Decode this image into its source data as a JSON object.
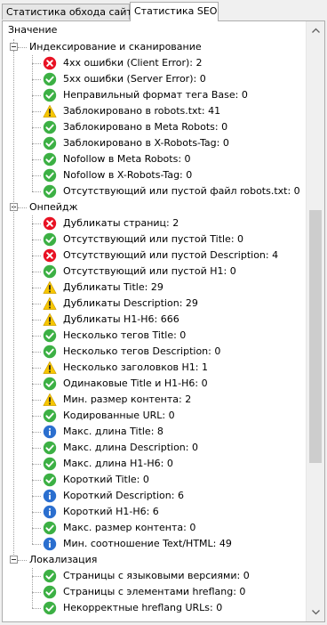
{
  "tabs": [
    {
      "label": "Статистика обхода сайта",
      "active": false
    },
    {
      "label": "Статистика SEO",
      "active": true
    }
  ],
  "column_header": "Значение",
  "colors": {
    "error": "#e81123",
    "warning": "#f7c600",
    "ok": "#3cb044",
    "info": "#2b6fcf"
  },
  "scroll": {
    "position_fraction": 0.55,
    "visible_fraction": 0.45
  },
  "tree": [
    {
      "label": "Индексирование и сканирование",
      "expanded": true,
      "items": [
        {
          "icon": "error-icon",
          "label": "4xx ошибки (Client Error): 2"
        },
        {
          "icon": "ok-icon",
          "label": "5xx ошибки (Server Error): 0"
        },
        {
          "icon": "ok-icon",
          "label": "Неправильный формат тега Base: 0"
        },
        {
          "icon": "warning-icon",
          "label": "Заблокировано в robots.txt: 41"
        },
        {
          "icon": "ok-icon",
          "label": "Заблокировано в Meta Robots: 0"
        },
        {
          "icon": "ok-icon",
          "label": "Заблокировано в X-Robots-Tag: 0"
        },
        {
          "icon": "ok-icon",
          "label": "Nofollow в Meta Robots: 0"
        },
        {
          "icon": "ok-icon",
          "label": "Nofollow в X-Robots-Tag: 0"
        },
        {
          "icon": "ok-icon",
          "label": "Отсутствующий или пустой файл robots.txt: 0"
        }
      ]
    },
    {
      "label": "Онпейдж",
      "expanded": true,
      "items": [
        {
          "icon": "error-icon",
          "label": "Дубликаты страниц: 2"
        },
        {
          "icon": "ok-icon",
          "label": "Отсутствующий или пустой Title: 0"
        },
        {
          "icon": "error-icon",
          "label": "Отсутствующий или пустой Description: 4"
        },
        {
          "icon": "ok-icon",
          "label": "Отсутствующий или пустой H1: 0"
        },
        {
          "icon": "warning-icon",
          "label": "Дубликаты Title: 29"
        },
        {
          "icon": "warning-icon",
          "label": "Дубликаты Description: 29"
        },
        {
          "icon": "warning-icon",
          "label": "Дубликаты H1-H6: 666"
        },
        {
          "icon": "ok-icon",
          "label": "Несколько тегов Title: 0"
        },
        {
          "icon": "ok-icon",
          "label": "Несколько тегов Description: 0"
        },
        {
          "icon": "warning-icon",
          "label": "Несколько заголовков H1: 1"
        },
        {
          "icon": "ok-icon",
          "label": "Одинаковые Title и H1-H6: 0"
        },
        {
          "icon": "warning-icon",
          "label": "Мин. размер контента: 2"
        },
        {
          "icon": "ok-icon",
          "label": "Кодированные URL: 0"
        },
        {
          "icon": "info-icon",
          "label": "Макс. длина Title: 8"
        },
        {
          "icon": "ok-icon",
          "label": "Макс. длина Description: 0"
        },
        {
          "icon": "ok-icon",
          "label": "Макс. длина H1-H6: 0"
        },
        {
          "icon": "ok-icon",
          "label": "Короткий Title: 0"
        },
        {
          "icon": "info-icon",
          "label": "Короткий Description: 6"
        },
        {
          "icon": "info-icon",
          "label": "Короткий H1-H6: 6"
        },
        {
          "icon": "ok-icon",
          "label": "Макс. размер контента: 0"
        },
        {
          "icon": "info-icon",
          "label": "Мин. соотношение Text/HTML: 49"
        }
      ]
    },
    {
      "label": "Локализация",
      "expanded": true,
      "items": [
        {
          "icon": "ok-icon",
          "label": "Страницы с языковыми версиями: 0"
        },
        {
          "icon": "ok-icon",
          "label": "Страницы с элементами hreflang: 0"
        },
        {
          "icon": "ok-icon",
          "label": "Некорректные hreflang URLs: 0"
        }
      ]
    }
  ]
}
